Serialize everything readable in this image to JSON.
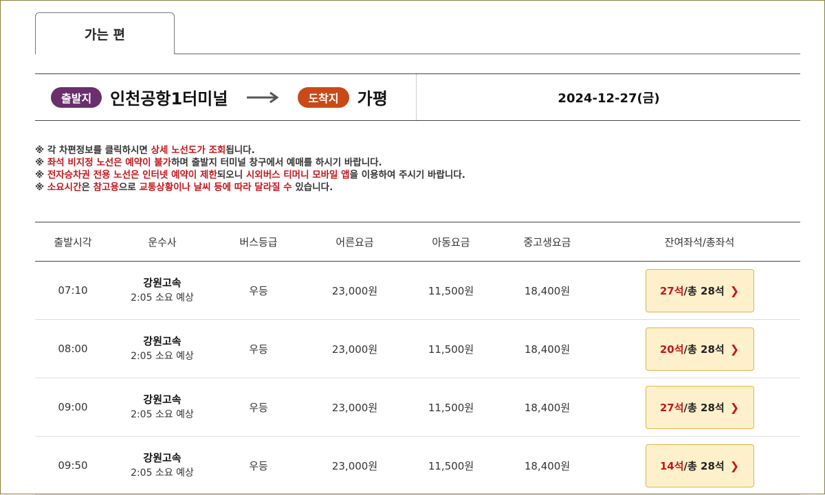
{
  "tabs": [
    {
      "label": "가는 편"
    }
  ],
  "route": {
    "depart_badge": "출발지",
    "depart_place": "인천공항1터미널",
    "arrive_badge": "도착지",
    "arrive_place": "가평",
    "date": "2024-12-27(금)"
  },
  "notices": [
    [
      {
        "t": "※ 각 차편정보를 클릭하시면 ",
        "r": false
      },
      {
        "t": "상세 노선도가 조회",
        "r": true
      },
      {
        "t": "됩니다.",
        "r": false
      }
    ],
    [
      {
        "t": "※ ",
        "r": false
      },
      {
        "t": "좌석 비지정 노선은 예약이 불가",
        "r": true
      },
      {
        "t": "하며 출발지 터미널 창구에서 예매를 하시기 바랍니다.",
        "r": false
      }
    ],
    [
      {
        "t": "※ ",
        "r": false
      },
      {
        "t": "전자승차권 전용 노선은 인터넷 예약이 제한",
        "r": true
      },
      {
        "t": "되오니 ",
        "r": false
      },
      {
        "t": "시외버스 티머니 모바일 앱",
        "r": true
      },
      {
        "t": "을 이용하여 주시기 바랍니다.",
        "r": false
      }
    ],
    [
      {
        "t": "※ ",
        "r": false
      },
      {
        "t": "소요시간",
        "r": true
      },
      {
        "t": "은 ",
        "r": false
      },
      {
        "t": "참고용",
        "r": true
      },
      {
        "t": "으로 ",
        "r": false
      },
      {
        "t": "교통상황이나 날씨 등에 따라 달라질 수",
        "r": true
      },
      {
        "t": " 있습니다.",
        "r": false
      }
    ]
  ],
  "table": {
    "headers": [
      "출발시각",
      "운수사",
      "버스등급",
      "어른요금",
      "아동요금",
      "중고생요금",
      "잔여좌석/총좌석"
    ],
    "rows": [
      {
        "time": "07:10",
        "company": "강원고속",
        "duration": "2:05 소요 예상",
        "grade": "우등",
        "adult": "23,000원",
        "child": "11,500원",
        "youth": "18,400원",
        "remain": "27석",
        "total": "/총 28석"
      },
      {
        "time": "08:00",
        "company": "강원고속",
        "duration": "2:05 소요 예상",
        "grade": "우등",
        "adult": "23,000원",
        "child": "11,500원",
        "youth": "18,400원",
        "remain": "20석",
        "total": "/총 28석"
      },
      {
        "time": "09:00",
        "company": "강원고속",
        "duration": "2:05 소요 예상",
        "grade": "우등",
        "adult": "23,000원",
        "child": "11,500원",
        "youth": "18,400원",
        "remain": "27석",
        "total": "/총 28석"
      },
      {
        "time": "09:50",
        "company": "강원고속",
        "duration": "2:05 소요 예상",
        "grade": "우등",
        "adult": "23,000원",
        "child": "11,500원",
        "youth": "18,400원",
        "remain": "14석",
        "total": "/총 28석"
      }
    ]
  },
  "icons": {
    "arrow": "right-arrow-icon",
    "chevron": "chevron-right-icon"
  },
  "colors": {
    "depart_badge": "#6a2f6c",
    "arrive_badge": "#c94a17",
    "highlight_red": "#c4161c",
    "seat_button_bg": "#fdf0cb",
    "seat_button_border": "#e0b44a"
  }
}
